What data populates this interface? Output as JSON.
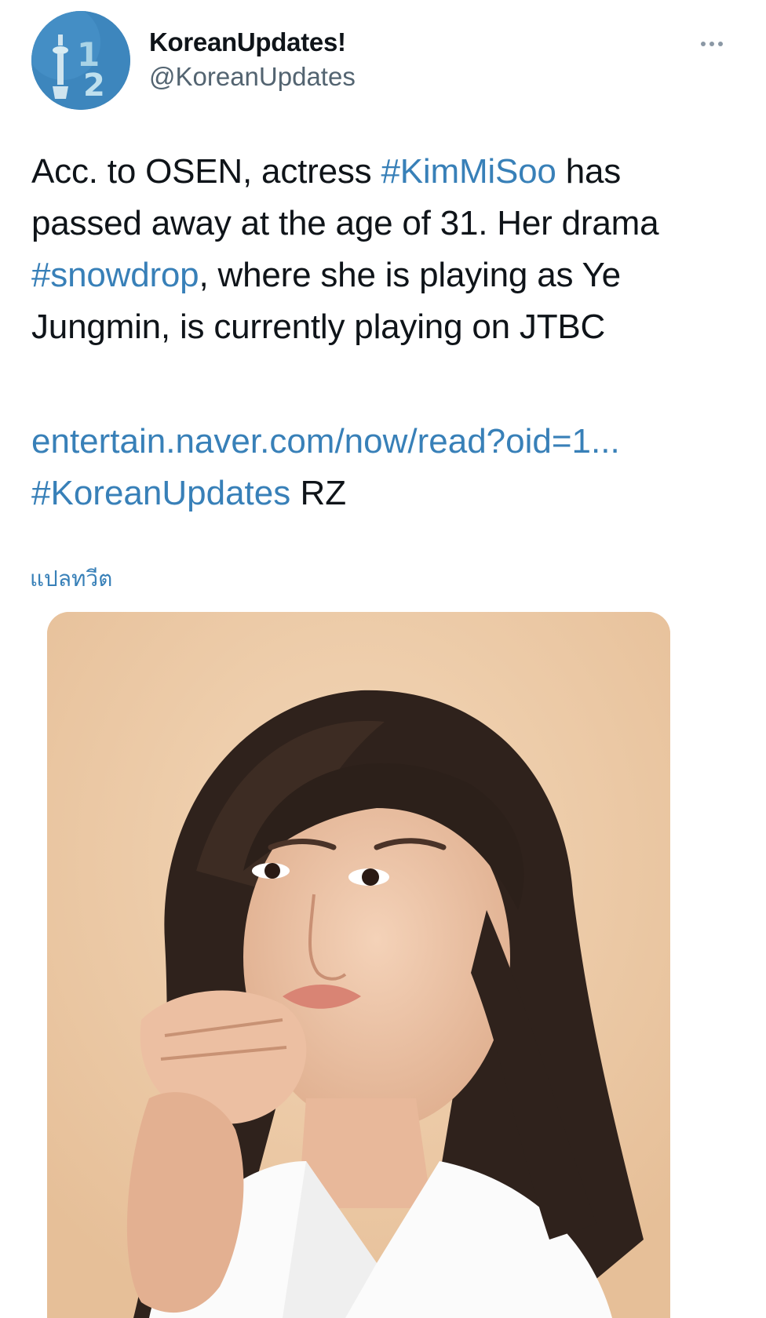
{
  "tweet": {
    "author": {
      "display_name": "KoreanUpdates!",
      "handle": "@KoreanUpdates",
      "avatar_icon": "tower-1-2-logo-icon"
    },
    "more_icon": "more-horizontal-icon",
    "text_segments": [
      {
        "text": "Acc. to OSEN, actress ",
        "type": "text"
      },
      {
        "text": "#KimMiSoo",
        "type": "hashtag"
      },
      {
        "text": " has passed away at the age of 31. Her drama ",
        "type": "text"
      },
      {
        "text": "#snowdrop",
        "type": "hashtag"
      },
      {
        "text": ", where she is playing as Ye Jungmin, is currently playing on JTBC",
        "type": "text"
      }
    ],
    "link_segments": [
      {
        "text": "entertain.naver.com/now/read?oid=1...",
        "type": "url"
      },
      {
        "text": " ",
        "type": "text"
      },
      {
        "text": "#KoreanUpdates",
        "type": "hashtag"
      },
      {
        "text": " RZ",
        "type": "text"
      }
    ],
    "translate_label": "แปลทวีต",
    "media": {
      "kind": "photo"
    }
  },
  "colors": {
    "link": "#3880b8",
    "text": "#0f1419",
    "secondary": "#536471",
    "photo_background": "#ecc9a6"
  }
}
